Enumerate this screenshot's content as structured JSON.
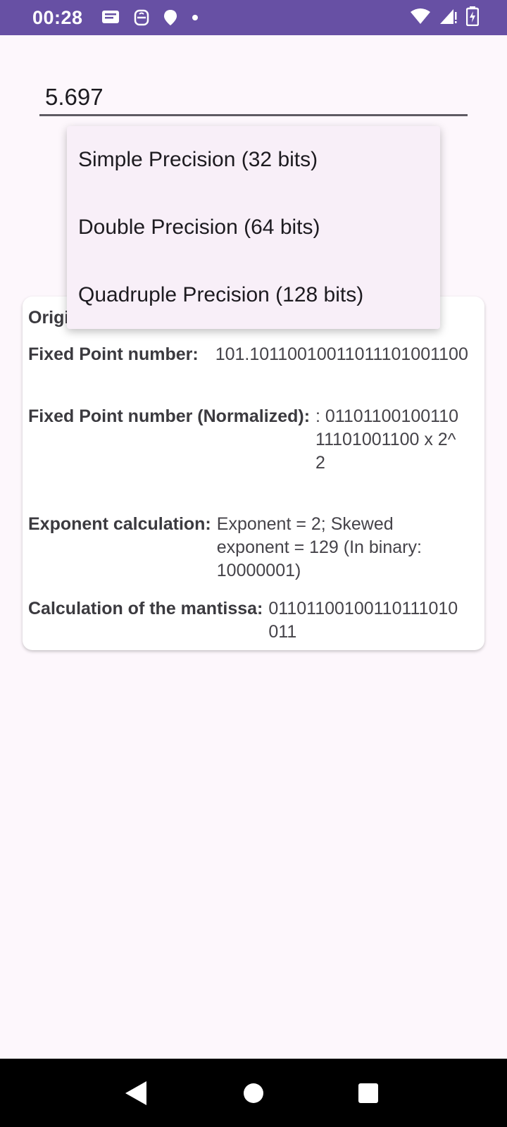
{
  "status_bar": {
    "time": "00:28",
    "left_icons": [
      "message-icon",
      "app-icon",
      "location-icon",
      "dot-icon"
    ],
    "right_icons": [
      "wifi-icon",
      "signal-icon",
      "battery-charging-icon"
    ]
  },
  "input": {
    "value": "5.697"
  },
  "dropdown": {
    "options": [
      "Simple Precision (32 bits)",
      "Double Precision (64 bits)",
      "Quadruple Precision (128 bits)"
    ]
  },
  "results": {
    "original_label": "Original number:",
    "fixed_point_label": "Fixed Point number:",
    "fixed_point_value": "101.10110010011011101001100",
    "normalized_label": "Fixed Point number (Normalized):",
    "normalized_value": ": 0110110010011011101001100 x 2^2",
    "exponent_label": "Exponent calculation:",
    "exponent_value": "Exponent = 2; Skewed exponent = 129 (In binary: 10000001)",
    "mantissa_label": "Calculation of the mantissa:",
    "mantissa_value": "01101100100110111010011"
  },
  "colors": {
    "status_bar": "#6750a4",
    "background": "#fdf7fc",
    "menu_background": "#f8eff8",
    "card_background": "#ffffff"
  }
}
